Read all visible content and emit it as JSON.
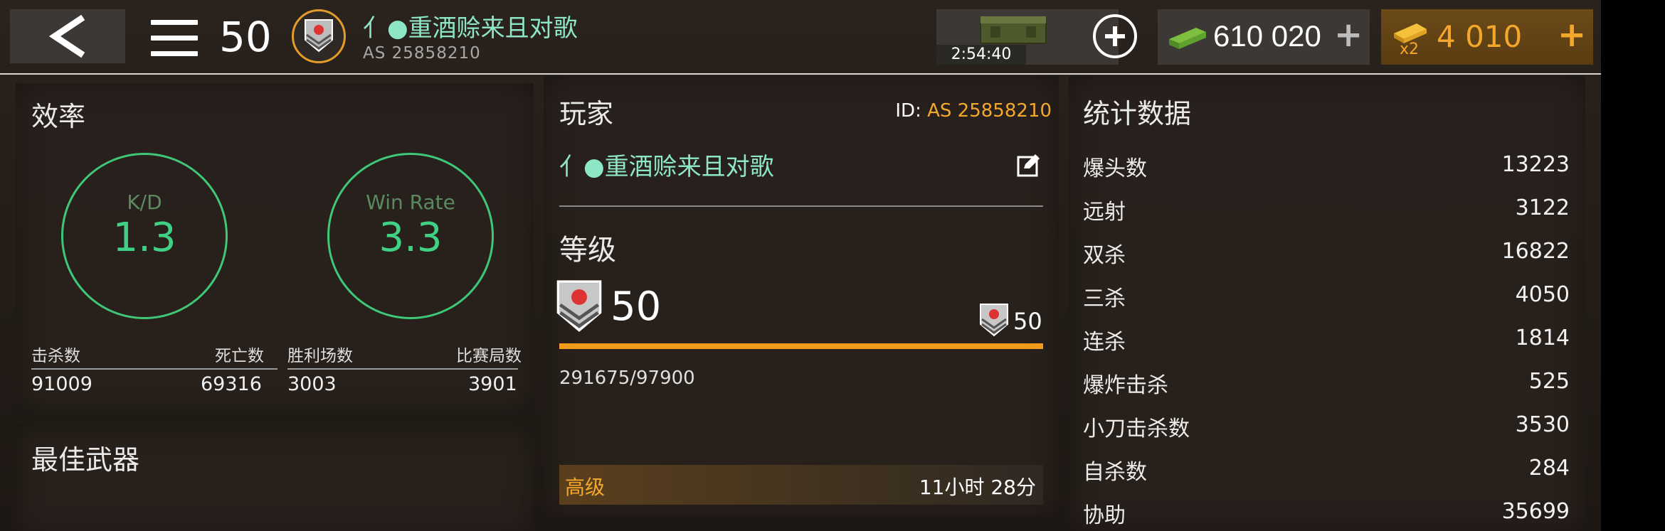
{
  "topbar": {
    "level": "50",
    "player_name": "亻●重酒赊来且对歌",
    "player_id": "AS 25858210",
    "crate_timer": "2:54:40",
    "cash": "610 020",
    "gold": "4 010",
    "gold_multiplier": "x2",
    "plus_glyph": "+"
  },
  "efficiency": {
    "title": "效率",
    "kd_label": "K/D",
    "kd_value": "1.3",
    "winrate_label": "Win Rate",
    "winrate_value": "3.3",
    "kills_label": "击杀数",
    "kills_value": "91009",
    "deaths_label": "死亡数",
    "deaths_value": "69316",
    "wins_label": "胜利场数",
    "wins_value": "3003",
    "matches_label": "比赛局数",
    "matches_value": "3901"
  },
  "best_weapon": {
    "title": "最佳武器"
  },
  "player": {
    "title": "玩家",
    "id_label": "ID:",
    "id_value": "AS 25858210",
    "name": "亻●重酒赊来且对歌"
  },
  "rank": {
    "title": "等级",
    "level": "50",
    "next_level": "50",
    "xp": "291675/97900",
    "progress": 1.0,
    "advanced_label": "高级",
    "advanced_time": "11小时 28分"
  },
  "stats": {
    "title": "统计数据",
    "rows": [
      {
        "name": "爆头数",
        "value": "13223"
      },
      {
        "name": "远射",
        "value": "3122"
      },
      {
        "name": "双杀",
        "value": "16822"
      },
      {
        "name": "三杀",
        "value": "4050"
      },
      {
        "name": "连杀",
        "value": "1814"
      },
      {
        "name": "爆炸击杀",
        "value": "525"
      },
      {
        "name": "小刀击杀数",
        "value": "3530"
      },
      {
        "name": "自杀数",
        "value": "284"
      },
      {
        "name": "协助",
        "value": "35699"
      }
    ]
  },
  "colors": {
    "accent_orange": "#f3a72b",
    "ring_green": "#3fc777",
    "name_teal": "#8de6c5"
  }
}
